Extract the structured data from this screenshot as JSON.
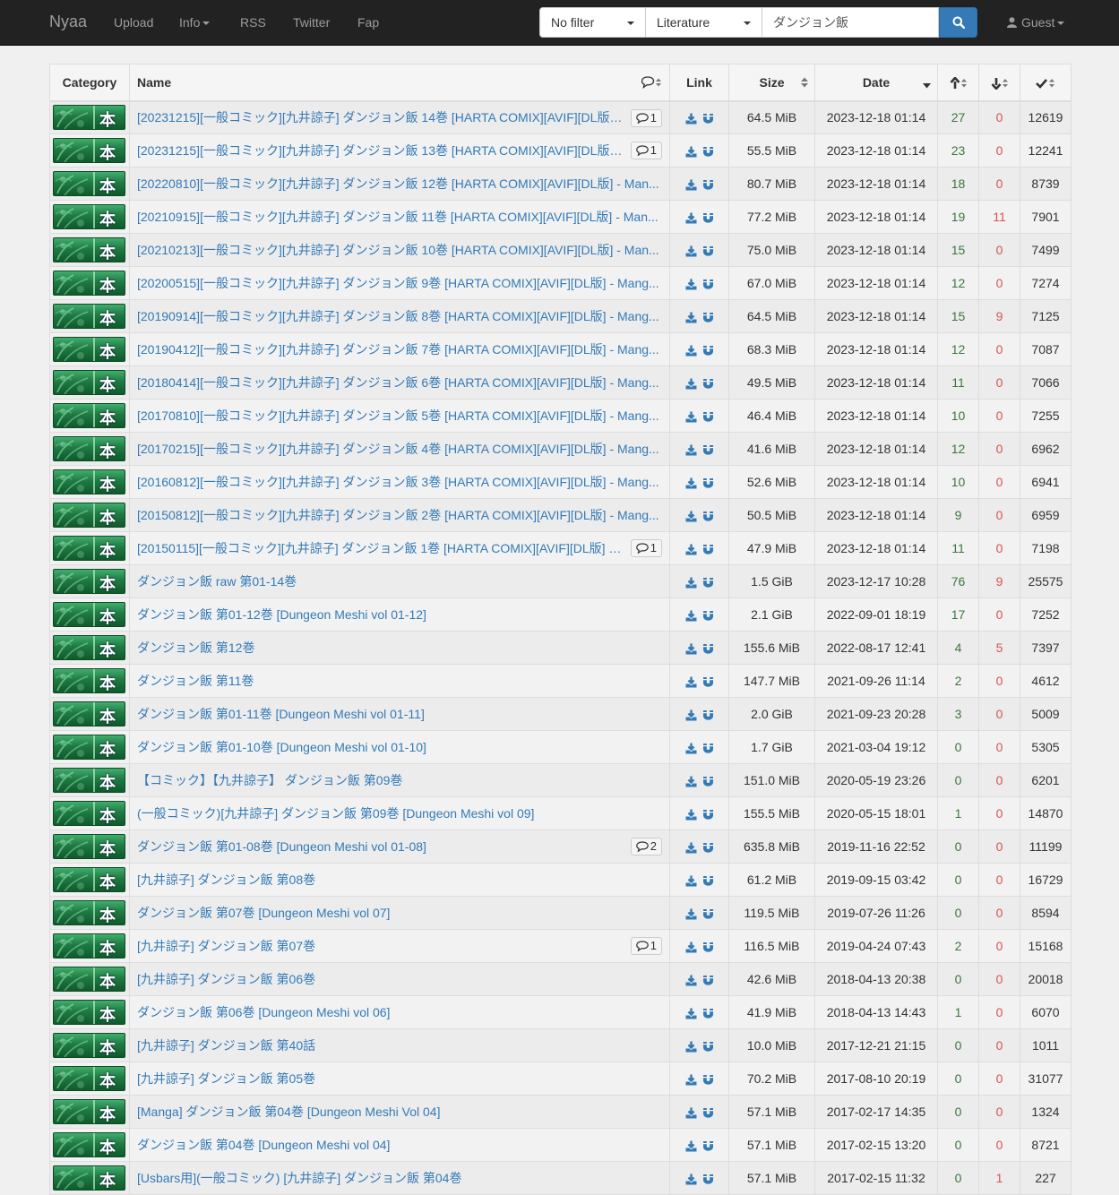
{
  "nav": {
    "brand": "Nyaa",
    "upload": "Upload",
    "info": "Info",
    "rss": "RSS",
    "twitter": "Twitter",
    "fap": "Fap",
    "filter": "No filter",
    "category": "Literature",
    "search_value": "ダンジョン飯",
    "guest": "Guest"
  },
  "table": {
    "headers": {
      "category": "Category",
      "name": "Name",
      "link": "Link",
      "size": "Size",
      "date": "Date"
    },
    "category_kanji": "本",
    "rows": [
      {
        "name": "[20231215][一般コミック][九井諒子] ダンジョン飯 14巻 [HARTA COMIX][AVIF][DL版] ...",
        "comments": "1",
        "size": "64.5 MiB",
        "date": "2023-12-18 01:14",
        "seeders": "27",
        "leechers": "0",
        "completed": "12619"
      },
      {
        "name": "[20231215][一般コミック][九井諒子] ダンジョン飯 13巻 [HARTA COMIX][AVIF][DL版] ...",
        "comments": "1",
        "size": "55.5 MiB",
        "date": "2023-12-18 01:14",
        "seeders": "23",
        "leechers": "0",
        "completed": "12241"
      },
      {
        "name": "[20220810][一般コミック][九井諒子] ダンジョン飯 12巻 [HARTA COMIX][AVIF][DL版] - Man...",
        "comments": "",
        "size": "80.7 MiB",
        "date": "2023-12-18 01:14",
        "seeders": "18",
        "leechers": "0",
        "completed": "8739"
      },
      {
        "name": "[20210915][一般コミック][九井諒子] ダンジョン飯 11巻 [HARTA COMIX][AVIF][DL版] - Man...",
        "comments": "",
        "size": "77.2 MiB",
        "date": "2023-12-18 01:14",
        "seeders": "19",
        "leechers": "11",
        "completed": "7901"
      },
      {
        "name": "[20210213][一般コミック][九井諒子] ダンジョン飯 10巻 [HARTA COMIX][AVIF][DL版] - Man...",
        "comments": "",
        "size": "75.0 MiB",
        "date": "2023-12-18 01:14",
        "seeders": "15",
        "leechers": "0",
        "completed": "7499"
      },
      {
        "name": "[20200515][一般コミック][九井諒子] ダンジョン飯 9巻 [HARTA COMIX][AVIF][DL版] - Mang...",
        "comments": "",
        "size": "67.0 MiB",
        "date": "2023-12-18 01:14",
        "seeders": "12",
        "leechers": "0",
        "completed": "7274"
      },
      {
        "name": "[20190914][一般コミック][九井諒子] ダンジョン飯 8巻 [HARTA COMIX][AVIF][DL版] - Mang...",
        "comments": "",
        "size": "64.5 MiB",
        "date": "2023-12-18 01:14",
        "seeders": "15",
        "leechers": "9",
        "completed": "7125"
      },
      {
        "name": "[20190412][一般コミック][九井諒子] ダンジョン飯 7巻 [HARTA COMIX][AVIF][DL版] - Mang...",
        "comments": "",
        "size": "68.3 MiB",
        "date": "2023-12-18 01:14",
        "seeders": "12",
        "leechers": "0",
        "completed": "7087"
      },
      {
        "name": "[20180414][一般コミック][九井諒子] ダンジョン飯 6巻 [HARTA COMIX][AVIF][DL版] - Mang...",
        "comments": "",
        "size": "49.5 MiB",
        "date": "2023-12-18 01:14",
        "seeders": "11",
        "leechers": "0",
        "completed": "7066"
      },
      {
        "name": "[20170810][一般コミック][九井諒子] ダンジョン飯 5巻 [HARTA COMIX][AVIF][DL版] - Mang...",
        "comments": "",
        "size": "46.4 MiB",
        "date": "2023-12-18 01:14",
        "seeders": "10",
        "leechers": "0",
        "completed": "7255"
      },
      {
        "name": "[20170215][一般コミック][九井諒子] ダンジョン飯 4巻 [HARTA COMIX][AVIF][DL版] - Mang...",
        "comments": "",
        "size": "41.6 MiB",
        "date": "2023-12-18 01:14",
        "seeders": "12",
        "leechers": "0",
        "completed": "6962"
      },
      {
        "name": "[20160812][一般コミック][九井諒子] ダンジョン飯 3巻 [HARTA COMIX][AVIF][DL版] - Mang...",
        "comments": "",
        "size": "52.6 MiB",
        "date": "2023-12-18 01:14",
        "seeders": "10",
        "leechers": "0",
        "completed": "6941"
      },
      {
        "name": "[20150812][一般コミック][九井諒子] ダンジョン飯 2巻 [HARTA COMIX][AVIF][DL版] - Mang...",
        "comments": "",
        "size": "50.5 MiB",
        "date": "2023-12-18 01:14",
        "seeders": "9",
        "leechers": "0",
        "completed": "6959"
      },
      {
        "name": "[20150115][一般コミック][九井諒子] ダンジョン飯 1巻 [HARTA COMIX][AVIF][DL版] - ...",
        "comments": "1",
        "size": "47.9 MiB",
        "date": "2023-12-18 01:14",
        "seeders": "11",
        "leechers": "0",
        "completed": "7198"
      },
      {
        "name": "ダンジョン飯 raw 第01-14巻",
        "comments": "",
        "size": "1.5 GiB",
        "date": "2023-12-17 10:28",
        "seeders": "76",
        "leechers": "9",
        "completed": "25575"
      },
      {
        "name": "ダンジョン飯 第01-12巻 [Dungeon Meshi vol 01-12]",
        "comments": "",
        "size": "2.1 GiB",
        "date": "2022-09-01 18:19",
        "seeders": "17",
        "leechers": "0",
        "completed": "7252"
      },
      {
        "name": "ダンジョン飯 第12巻",
        "comments": "",
        "size": "155.6 MiB",
        "date": "2022-08-17 12:41",
        "seeders": "4",
        "leechers": "5",
        "completed": "7397"
      },
      {
        "name": "ダンジョン飯 第11巻",
        "comments": "",
        "size": "147.7 MiB",
        "date": "2021-09-26 11:14",
        "seeders": "2",
        "leechers": "0",
        "completed": "4612"
      },
      {
        "name": "ダンジョン飯 第01-11巻 [Dungeon Meshi vol 01-11]",
        "comments": "",
        "size": "2.0 GiB",
        "date": "2021-09-23 20:28",
        "seeders": "3",
        "leechers": "0",
        "completed": "5009"
      },
      {
        "name": "ダンジョン飯 第01-10巻 [Dungeon Meshi vol 01-10]",
        "comments": "",
        "size": "1.7 GiB",
        "date": "2021-03-04 19:12",
        "seeders": "0",
        "leechers": "0",
        "completed": "5305"
      },
      {
        "name": "【コミック】【九井諒子】 ダンジョン飯 第09巻",
        "comments": "",
        "size": "151.0 MiB",
        "date": "2020-05-19 23:26",
        "seeders": "0",
        "leechers": "0",
        "completed": "6201"
      },
      {
        "name": "(一般コミック)[九井諒子] ダンジョン飯 第09巻 [Dungeon Meshi vol 09]",
        "comments": "",
        "size": "155.5 MiB",
        "date": "2020-05-15 18:01",
        "seeders": "1",
        "leechers": "0",
        "completed": "14870"
      },
      {
        "name": "ダンジョン飯 第01-08巻 [Dungeon Meshi vol 01-08]",
        "comments": "2",
        "size": "635.8 MiB",
        "date": "2019-11-16 22:52",
        "seeders": "0",
        "leechers": "0",
        "completed": "11199"
      },
      {
        "name": "[九井諒子] ダンジョン飯 第08巻",
        "comments": "",
        "size": "61.2 MiB",
        "date": "2019-09-15 03:42",
        "seeders": "0",
        "leechers": "0",
        "completed": "16729"
      },
      {
        "name": "ダンジョン飯 第07巻 [Dungeon Meshi vol 07]",
        "comments": "",
        "size": "119.5 MiB",
        "date": "2019-07-26 11:26",
        "seeders": "0",
        "leechers": "0",
        "completed": "8594"
      },
      {
        "name": "[九井諒子] ダンジョン飯 第07巻",
        "comments": "1",
        "size": "116.5 MiB",
        "date": "2019-04-24 07:43",
        "seeders": "2",
        "leechers": "0",
        "completed": "15168"
      },
      {
        "name": "[九井諒子] ダンジョン飯 第06巻",
        "comments": "",
        "size": "42.6 MiB",
        "date": "2018-04-13 20:38",
        "seeders": "0",
        "leechers": "0",
        "completed": "20018"
      },
      {
        "name": "ダンジョン飯 第06巻 [Dungeon Meshi vol 06]",
        "comments": "",
        "size": "41.9 MiB",
        "date": "2018-04-13 14:43",
        "seeders": "1",
        "leechers": "0",
        "completed": "6070"
      },
      {
        "name": "[九井諒子] ダンジョン飯 第40話",
        "comments": "",
        "size": "10.0 MiB",
        "date": "2017-12-21 21:15",
        "seeders": "0",
        "leechers": "0",
        "completed": "1011"
      },
      {
        "name": "[九井諒子] ダンジョン飯 第05巻",
        "comments": "",
        "size": "70.2 MiB",
        "date": "2017-08-10 20:19",
        "seeders": "0",
        "leechers": "0",
        "completed": "31077"
      },
      {
        "name": "[Manga] ダンジョン飯 第04巻 [Dungeon Meshi Vol 04]",
        "comments": "",
        "size": "57.1 MiB",
        "date": "2017-02-17 14:35",
        "seeders": "0",
        "leechers": "0",
        "completed": "1324"
      },
      {
        "name": "ダンジョン飯 第04巻 [Dungeon Meshi vol 04]",
        "comments": "",
        "size": "57.1 MiB",
        "date": "2017-02-15 13:20",
        "seeders": "0",
        "leechers": "0",
        "completed": "8721"
      },
      {
        "name": "[Usbars用](一般コミック) [九井諒子] ダンジョン飯 第04巻",
        "comments": "",
        "size": "57.1 MiB",
        "date": "2017-02-15 11:32",
        "seeders": "0",
        "leechers": "1",
        "completed": "227"
      }
    ]
  }
}
